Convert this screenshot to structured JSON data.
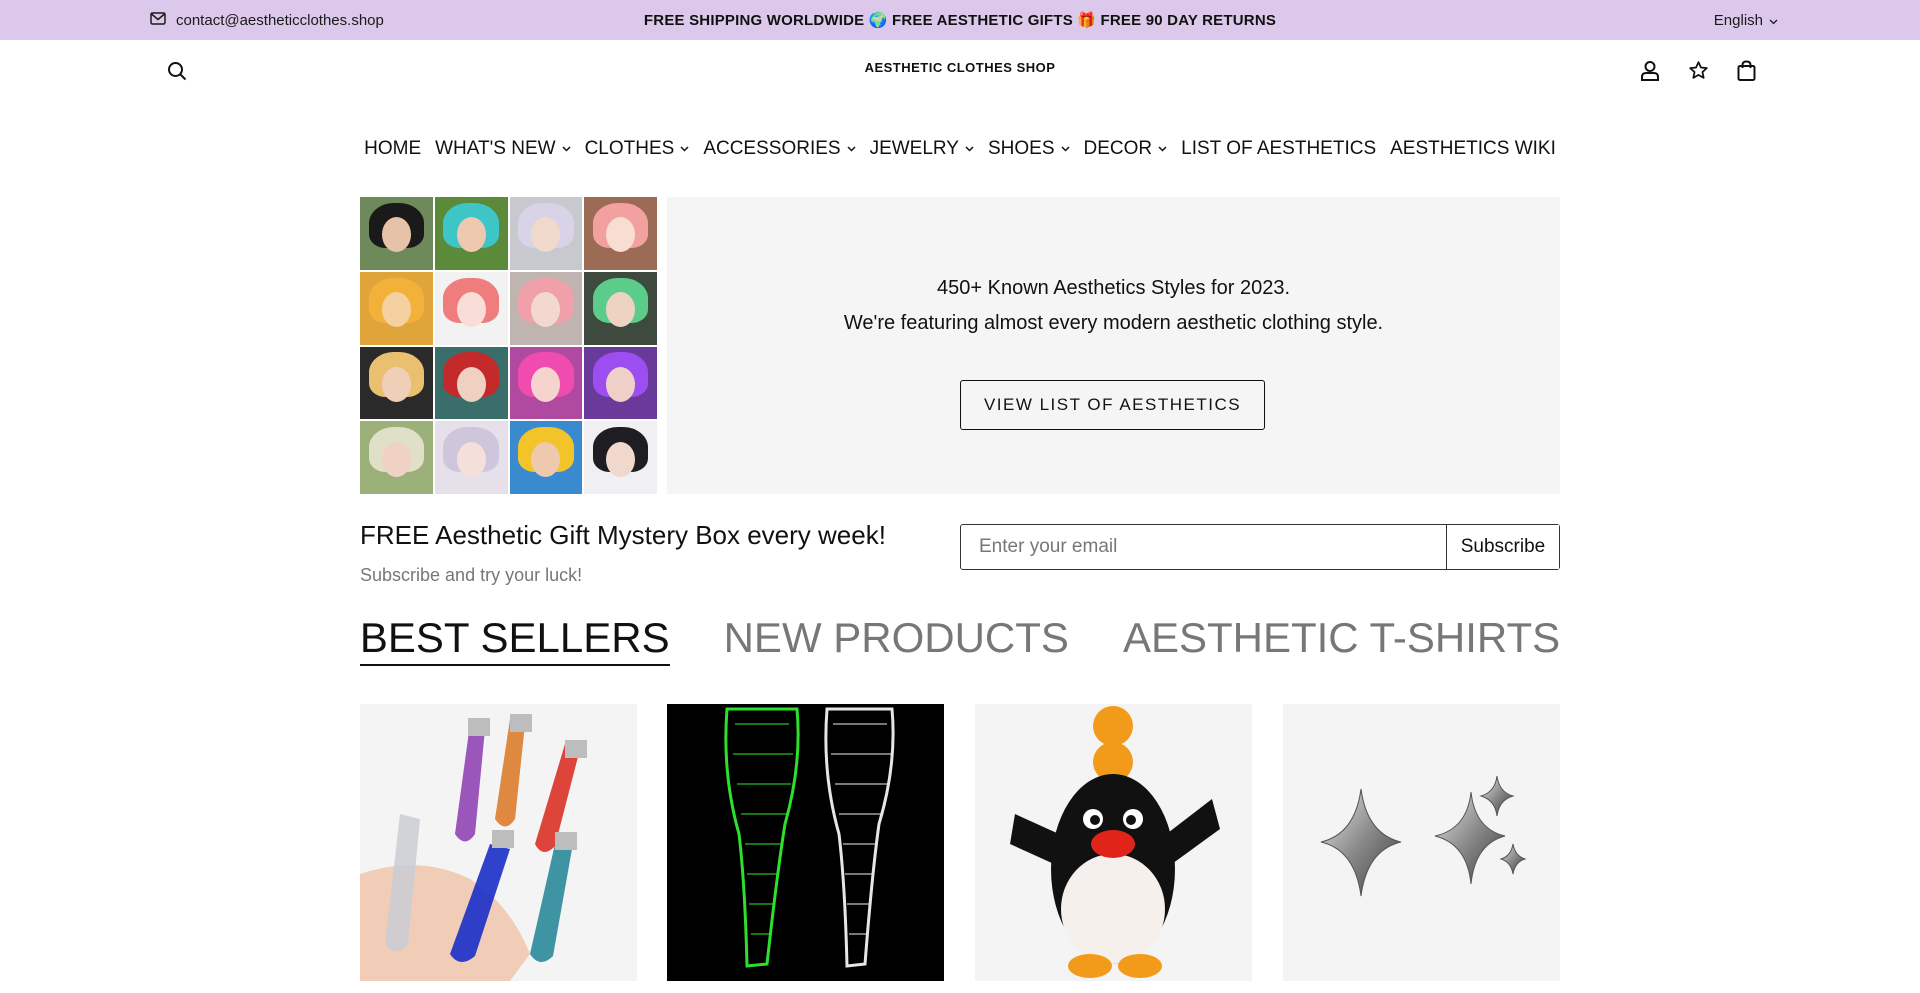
{
  "announcement": {
    "email": "contact@aestheticclothes.shop",
    "promo": "FREE SHIPPING WORLDWIDE 🌍 FREE AESTHETIC GIFTS 🎁 FREE 90 DAY RETURNS",
    "language": "English"
  },
  "header": {
    "logo": "AESTHETIC CLOTHES SHOP",
    "icons": [
      "search-icon",
      "account-icon",
      "wishlist-star-icon",
      "cart-bag-icon"
    ]
  },
  "nav": {
    "items": [
      {
        "label": "HOME",
        "dropdown": false
      },
      {
        "label": "WHAT'S NEW",
        "dropdown": true
      },
      {
        "label": "CLOTHES",
        "dropdown": true
      },
      {
        "label": "ACCESSORIES",
        "dropdown": true
      },
      {
        "label": "JEWELRY",
        "dropdown": true
      },
      {
        "label": "SHOES",
        "dropdown": true
      },
      {
        "label": "DECOR",
        "dropdown": true
      },
      {
        "label": "LIST OF AESTHETICS",
        "dropdown": false
      },
      {
        "label": "AESTHETICS WIKI",
        "dropdown": false
      }
    ]
  },
  "hero": {
    "line1": "450+ Known Aesthetics Styles for 2023.",
    "line2": "We're featuring almost every modern aesthetic clothing style.",
    "button": "VIEW LIST OF AESTHETICS"
  },
  "newsletter": {
    "title": "FREE Aesthetic Gift Mystery Box every week!",
    "subtitle": "Subscribe and try your luck!",
    "placeholder": "Enter your email",
    "button": "Subscribe"
  },
  "tabs": [
    {
      "label": "BEST SELLERS",
      "active": true
    },
    {
      "label": "NEW PRODUCTS",
      "active": false
    },
    {
      "label": "AESTHETIC T-SHIRTS",
      "active": false
    }
  ],
  "colors": {
    "announcement_bg": "#dcc8ea",
    "hero_panel_bg": "#f5f5f5",
    "tab_inactive": "#777777",
    "text": "#111111"
  }
}
